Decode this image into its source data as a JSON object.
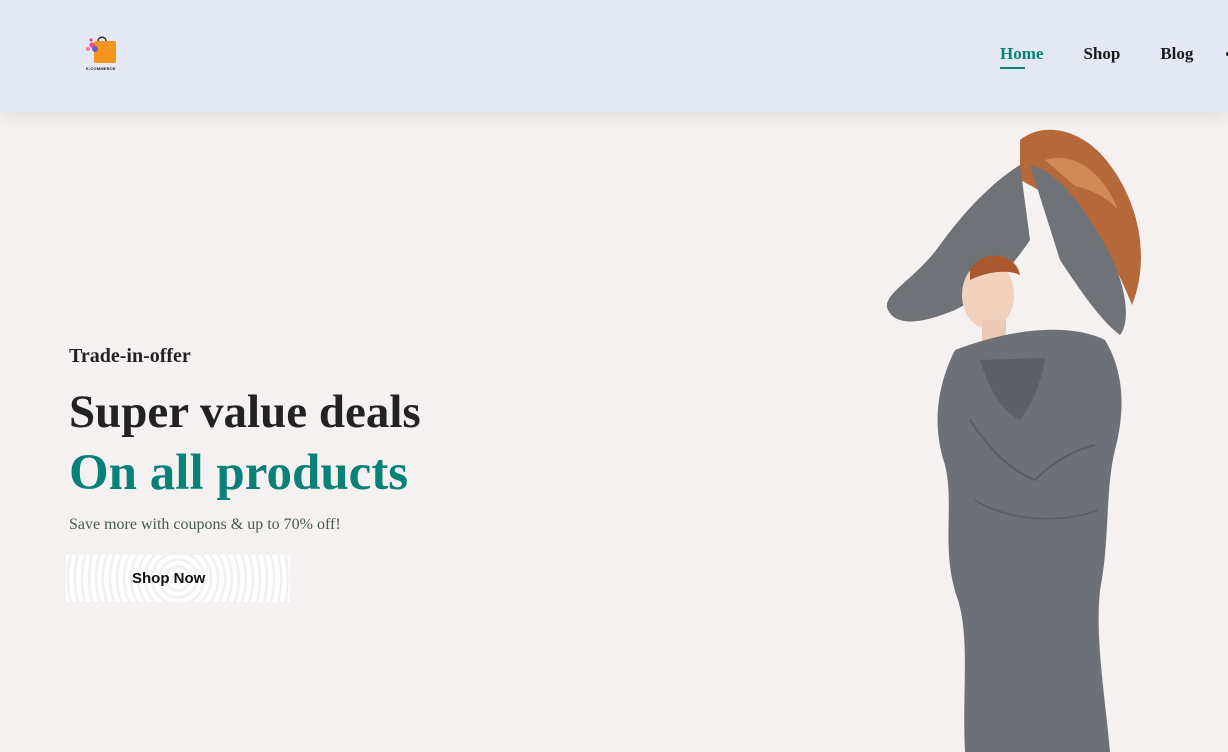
{
  "brand": {
    "logo_text": "E-COMMERCE",
    "colors": {
      "bag": "#f7941d",
      "accent": "#088178",
      "dot1": "#e94b8a",
      "dot2": "#6a5acd"
    }
  },
  "nav": {
    "items": [
      {
        "label": "Home",
        "active": true
      },
      {
        "label": "Shop",
        "active": false
      },
      {
        "label": "Blog",
        "active": false
      }
    ]
  },
  "hero": {
    "kicker": "Trade-in-offer",
    "headline": "Super value deals",
    "headline_accent": "On all products",
    "subtext": "Save more with coupons & up to 70% off!",
    "cta_label": "Shop Now"
  },
  "colors": {
    "header_bg": "#e4e8f4",
    "page_bg": "#f5f1f0",
    "accent": "#088178",
    "text_dark": "#222222",
    "subtext": "#465b52"
  }
}
